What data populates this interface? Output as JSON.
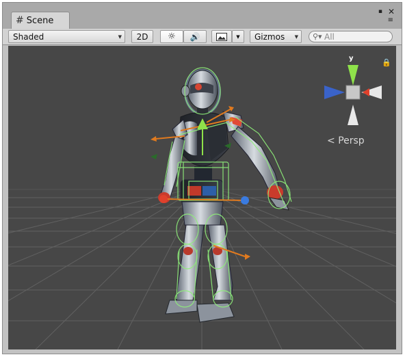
{
  "window": {
    "tab_label": "Scene",
    "tab_icon": "scene-grid-icon",
    "maximize_icon": "▪",
    "close_icon": "✕",
    "menu_icon": "≡"
  },
  "toolbar": {
    "shading_mode": "Shaded",
    "twod_label": "2D",
    "lighting_icon": "sun-icon",
    "audio_icon": "speaker-icon",
    "effects_icon": "image-icon",
    "gizmos_label": "Gizmos",
    "search_placeholder": "All"
  },
  "viewport": {
    "projection_label": "Persp",
    "axis_y_label": "y",
    "colors": {
      "background": "#474747",
      "collider_wire": "#8ff07a",
      "axis_x": "#e0412c",
      "axis_y": "#8fe24a",
      "axis_z": "#3a7be0"
    }
  }
}
